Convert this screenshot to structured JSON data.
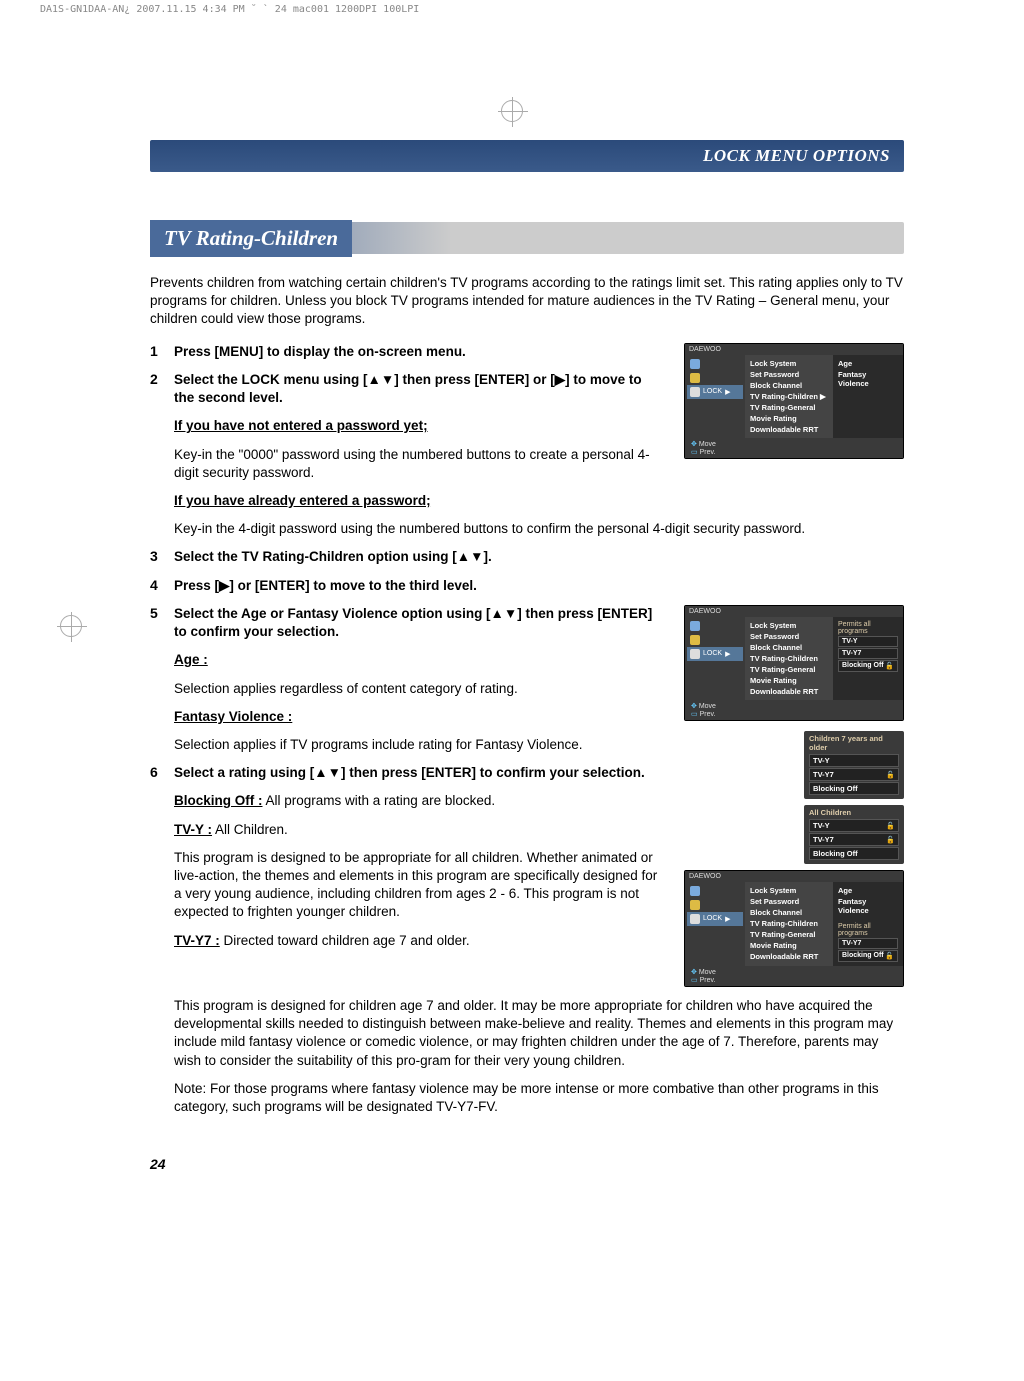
{
  "page_marks": "DA1S-GN1DAA-AN¿   2007.11.15 4:34 PM   ˘ ` 24   mac001   1200DPI 100LPI",
  "banner": {
    "text": "LOCK MENU OPTIONS"
  },
  "heading": "TV Rating-Children",
  "intro": "Prevents children from watching certain children's TV programs according to the ratings limit set. This rating applies only to TV programs for children. Unless you block TV programs intended for mature audiences in the TV Rating – General menu, your children could view those programs.",
  "steps": {
    "s1": {
      "num": "1",
      "text": "Press [MENU] to display the on-screen menu."
    },
    "s2": {
      "num": "2",
      "text": "Select the LOCK menu using [▲▼] then press [ENTER] or [▶] to move to the second level."
    },
    "s2a_head": "If you have not entered a password yet;",
    "s2a_body": "Key-in the \"0000\" password using the numbered buttons to create a personal 4-digit security password.",
    "s2b_head": "If you have already entered a password;",
    "s2b_body": "Key-in the 4-digit password using the numbered buttons to confirm the personal 4-digit security password.",
    "s3": {
      "num": "3",
      "text": "Select the TV Rating-Children option using [▲▼]."
    },
    "s4": {
      "num": "4",
      "text": "Press [▶] or [ENTER] to move to the third level."
    },
    "s5": {
      "num": "5",
      "text": "Select the Age or Fantasy Violence option using [▲▼] then press [ENTER] to confirm your selection."
    },
    "s5_age_head": "Age :",
    "s5_age_body": "Selection applies regardless of content category of rating.",
    "s5_fv_head": "Fantasy Violence :",
    "s5_fv_body": "Selection applies if TV programs include rating for Fantasy Violence.",
    "s6": {
      "num": "6",
      "text": "Select a rating using [▲▼] then press [ENTER] to confirm your selection."
    },
    "s6_block_head": "Blocking Off :",
    "s6_block_body": " All programs with a rating are blocked.",
    "s6_tvy_head": "TV-Y :",
    "s6_tvy_label": " All Children.",
    "s6_tvy_body": "This program is designed to be appropriate for all children. Whether animated or live-action, the themes and elements in this program are specifically designed for a very young audience, including children from ages 2 - 6. This program is not expected to frighten younger children.",
    "s6_tvy7_head": "TV-Y7 :",
    "s6_tvy7_label": " Directed toward children age 7 and older.",
    "s6_tvy7_body": "This program is designed for children age 7 and older. It may be more appropriate for children who have acquired the developmental skills needed to distinguish between make-believe and reality. Themes and elements in this program may include mild fantasy violence or comedic violence, or may frighten children under the age of 7. Therefore, parents may wish to consider the suitability of this pro-gram for their very young children.",
    "note": "Note: For those programs where fantasy violence may be more intense or more combative than other programs in this category, such programs will be designated TV-Y7-FV."
  },
  "osd_common": {
    "brand": "DAEWOO",
    "lock_tab": "LOCK",
    "move": "Move",
    "prev": "Prev.",
    "arrow": "▶",
    "items": {
      "lock_system": "Lock System",
      "set_password": "Set Password",
      "block_channel": "Block Channel",
      "tvr_children": "TV Rating-Children",
      "tvr_general": "TV Rating-General",
      "movie_rating": "Movie Rating",
      "dl_rrt": "Downloadable RRT"
    },
    "sub": {
      "age": "Age",
      "fv": "Fantasy Violence",
      "permits": "Permits all programs",
      "tvy": "TV-Y",
      "tvy7": "TV-Y7",
      "blocking_off": "Blocking Off"
    }
  },
  "mini1": {
    "title": "Children 7 years and older",
    "r1": "TV-Y",
    "r2": "TV-Y7",
    "r3": "Blocking Off"
  },
  "mini2": {
    "title": "All Children",
    "r1": "TV-Y",
    "r2": "TV-Y7",
    "r3": "Blocking Off"
  },
  "chart_data": {
    "type": "table",
    "title": "TV Rating-Children OSD menu states",
    "rows": [
      {
        "screen": 1,
        "selected": "TV Rating-Children",
        "submenu": [
          "Age",
          "Fantasy Violence"
        ]
      },
      {
        "screen": 2,
        "selected": "TV Rating-Children > Age",
        "panel_title": "Permits all programs",
        "options": [
          "TV-Y",
          "TV-Y7",
          "Blocking Off"
        ]
      },
      {
        "screen": 3,
        "selected": "TV Rating-Children > Fantasy Violence",
        "subpanel": "Permits all programs",
        "options": [
          "TV-Y7",
          "Blocking Off"
        ]
      }
    ],
    "popups": [
      {
        "title": "Children 7 years and older",
        "rows": [
          "TV-Y",
          "TV-Y7",
          "Blocking Off"
        ],
        "locked": "TV-Y7"
      },
      {
        "title": "All Children",
        "rows": [
          "TV-Y",
          "TV-Y7",
          "Blocking Off"
        ],
        "locked": [
          "TV-Y",
          "TV-Y7"
        ]
      }
    ]
  },
  "page_num": "24"
}
